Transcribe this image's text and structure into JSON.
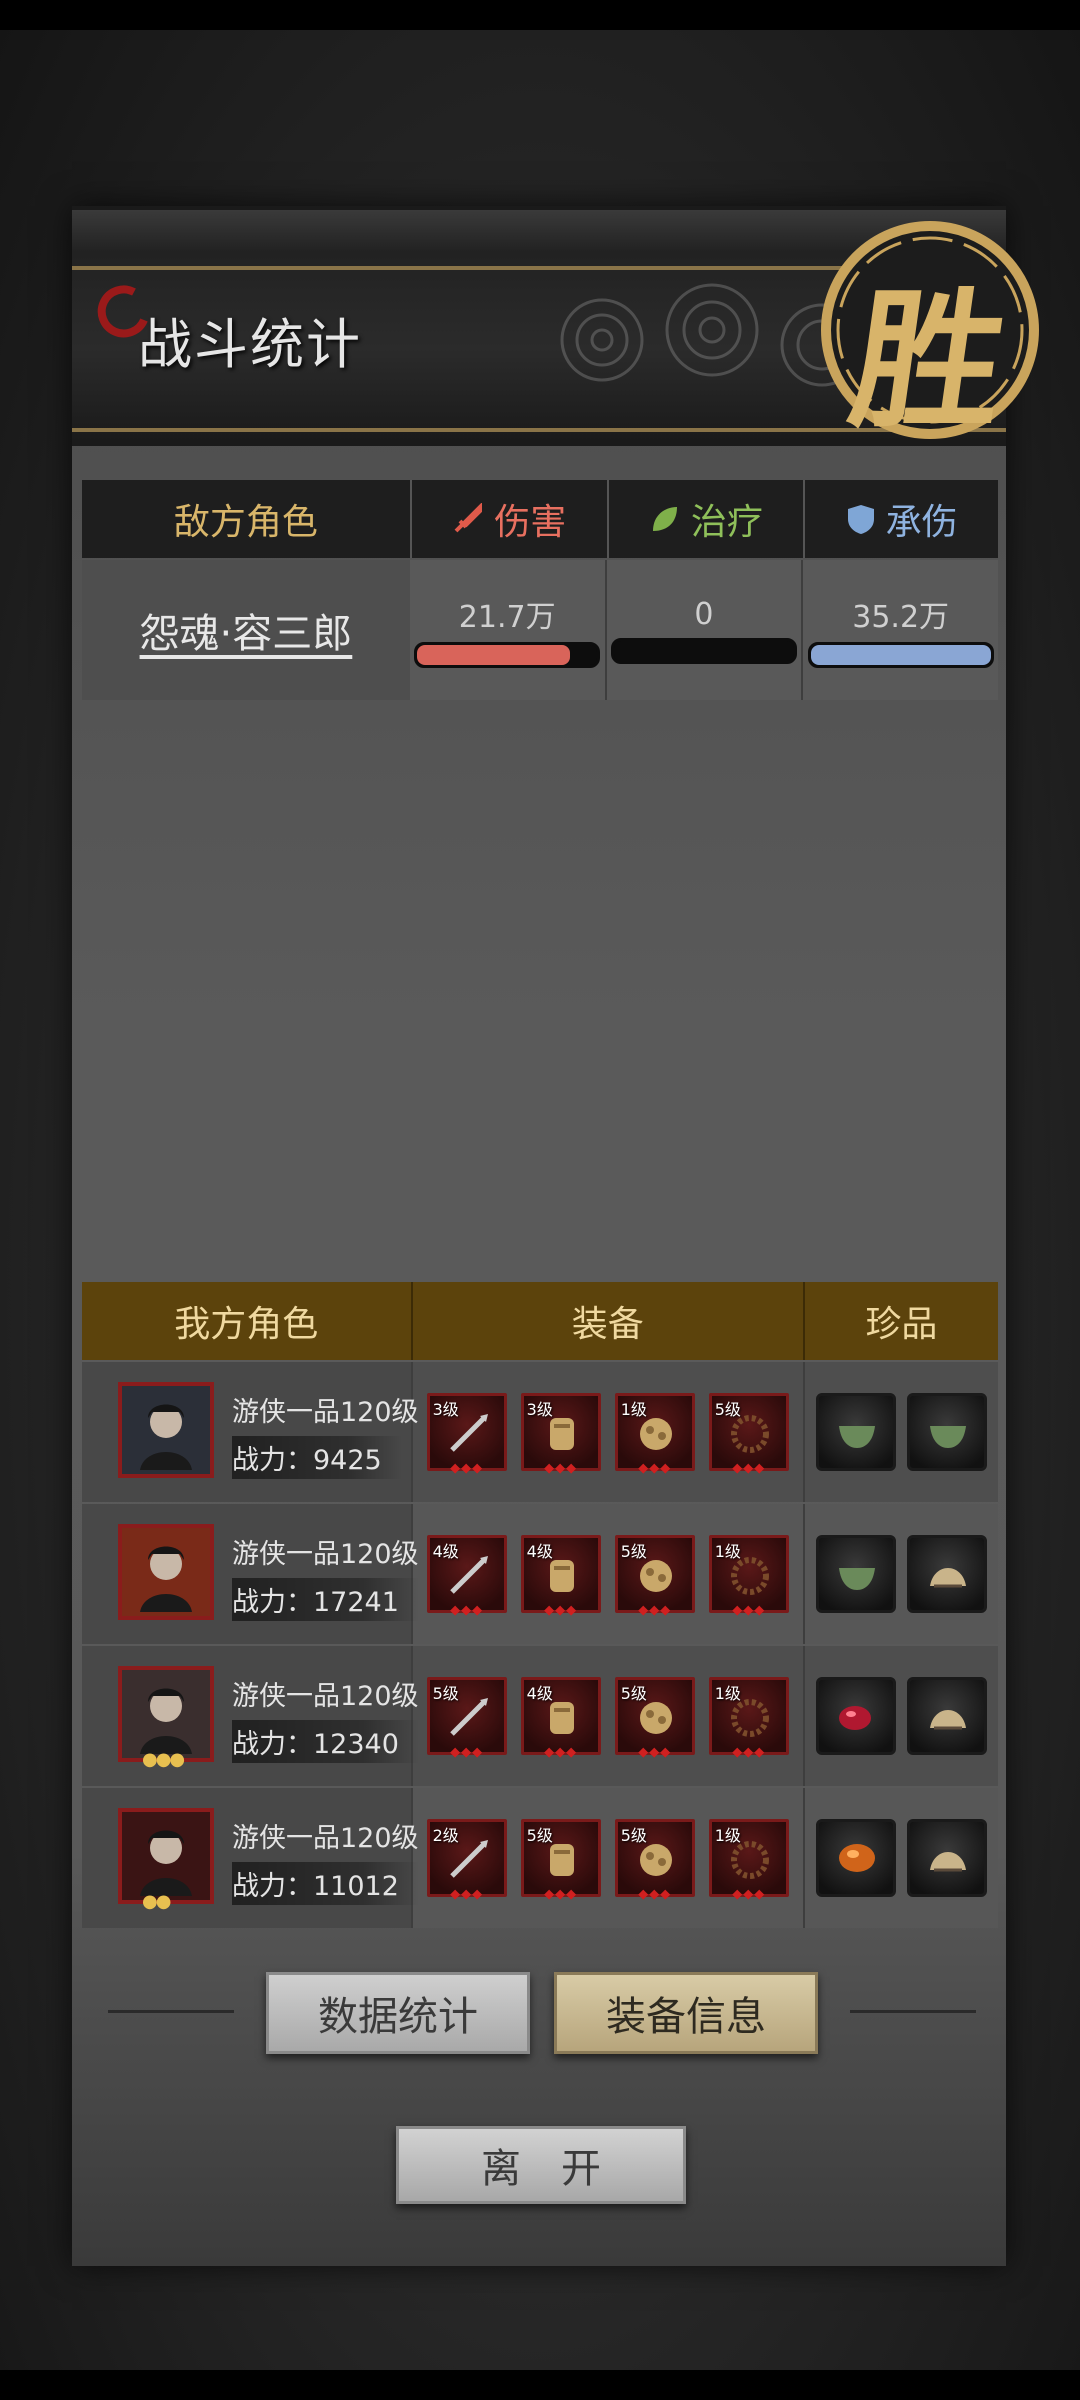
{
  "header": {
    "title": "战斗统计",
    "victory_char": "胜"
  },
  "enemy_table": {
    "headers": {
      "role": "敌方角色",
      "damage": "伤害",
      "heal": "治疗",
      "tank": "承伤"
    },
    "row": {
      "name": "怨魂·容三郎",
      "damage": "21.7万",
      "damage_fraction": 0.85,
      "heal": "0",
      "heal_fraction": 0,
      "tank": "35.2万",
      "tank_fraction": 1.0
    }
  },
  "ally_table": {
    "headers": {
      "role": "我方角色",
      "equip": "装备",
      "treasure": "珍品"
    },
    "rows": [
      {
        "rank": "游侠一品120级",
        "power": "战力：9425",
        "stars": "",
        "equip": [
          "3级",
          "3级",
          "1级",
          "5级"
        ],
        "treasures": [
          "bowl",
          "bowl"
        ]
      },
      {
        "rank": "游侠一品120级",
        "power": "战力：17241",
        "stars": "",
        "equip": [
          "4级",
          "4级",
          "5级",
          "1级"
        ],
        "treasures": [
          "bowl",
          "comb"
        ]
      },
      {
        "rank": "游侠一品120级",
        "power": "战力：12340",
        "stars": "●●●",
        "equip": [
          "5级",
          "4级",
          "5级",
          "1级"
        ],
        "treasures": [
          "ruby",
          "comb"
        ]
      },
      {
        "rank": "游侠一品120级",
        "power": "战力：11012",
        "stars": "●●",
        "equip": [
          "2级",
          "5级",
          "5级",
          "1级"
        ],
        "treasures": [
          "amber",
          "comb"
        ]
      }
    ]
  },
  "buttons": {
    "stats": "数据统计",
    "equip_info": "装备信息",
    "leave": "离开"
  },
  "colors": {
    "damage": "#e87060",
    "heal": "#8fc05a",
    "tank": "#8fb3e0",
    "gold": "#d9b66a"
  }
}
